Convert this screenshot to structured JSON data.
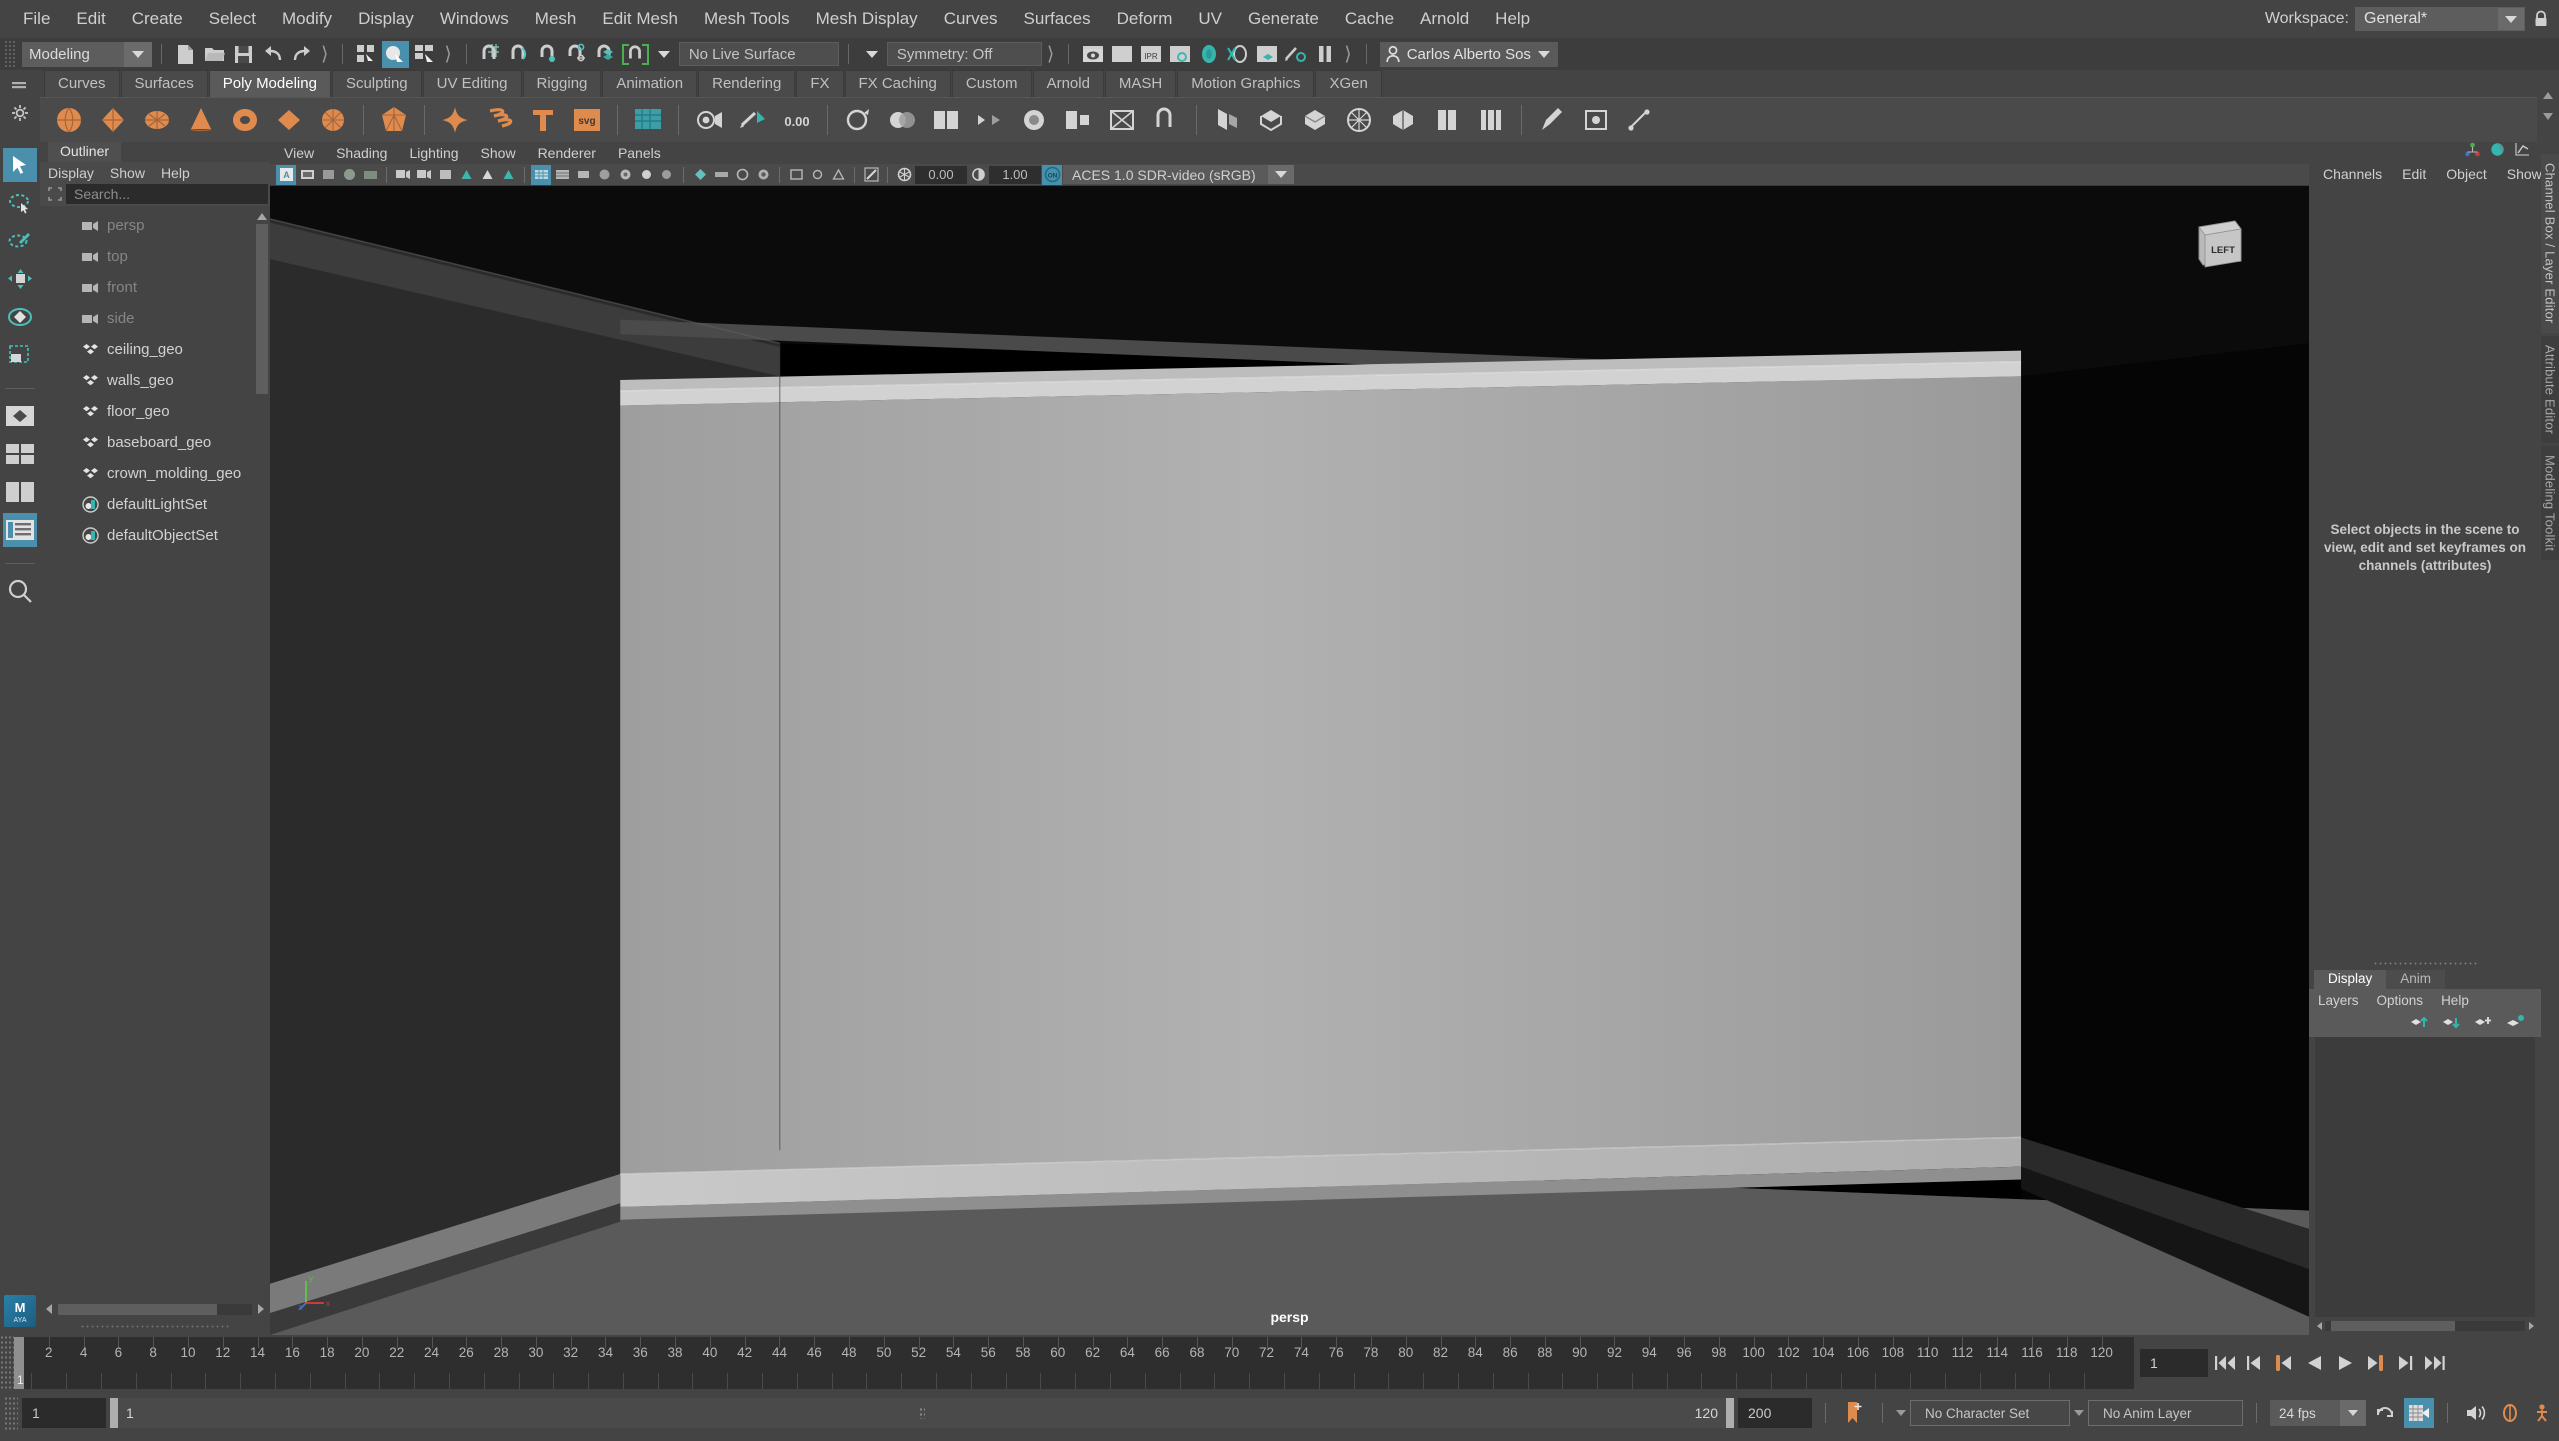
{
  "menubar": {
    "items": [
      "File",
      "Edit",
      "Create",
      "Select",
      "Modify",
      "Display",
      "Windows",
      "Mesh",
      "Edit Mesh",
      "Mesh Tools",
      "Mesh Display",
      "Curves",
      "Surfaces",
      "Deform",
      "UV",
      "Generate",
      "Cache",
      "Arnold",
      "Help"
    ],
    "workspace_label": "Workspace:",
    "workspace_value": "General*"
  },
  "statusline": {
    "menu_set": "Modeling",
    "live_surface": "No Live Surface",
    "symmetry": "Symmetry: Off",
    "user": "Carlos Alberto Sos"
  },
  "shelf": {
    "tabs": [
      "Curves",
      "Surfaces",
      "Poly Modeling",
      "Sculpting",
      "UV Editing",
      "Rigging",
      "Animation",
      "Rendering",
      "FX",
      "FX Caching",
      "Custom",
      "Arnold",
      "MASH",
      "Motion Graphics",
      "XGen"
    ],
    "active_tab": "Poly Modeling",
    "svg_label": "svg"
  },
  "outliner": {
    "title": "Outliner",
    "menu": [
      "Display",
      "Show",
      "Help"
    ],
    "search_placeholder": "Search...",
    "items": [
      {
        "label": "persp",
        "icon": "camera-icon",
        "dim": true
      },
      {
        "label": "top",
        "icon": "camera-icon",
        "dim": true
      },
      {
        "label": "front",
        "icon": "camera-icon",
        "dim": true
      },
      {
        "label": "side",
        "icon": "camera-icon",
        "dim": true
      },
      {
        "label": "ceiling_geo",
        "icon": "mesh-icon",
        "dim": false
      },
      {
        "label": "walls_geo",
        "icon": "mesh-icon",
        "dim": false
      },
      {
        "label": "floor_geo",
        "icon": "mesh-icon",
        "dim": false
      },
      {
        "label": "baseboard_geo",
        "icon": "mesh-icon",
        "dim": false
      },
      {
        "label": "crown_molding_geo",
        "icon": "mesh-icon",
        "dim": false
      },
      {
        "label": "defaultLightSet",
        "icon": "set-icon",
        "dim": false
      },
      {
        "label": "defaultObjectSet",
        "icon": "set-icon",
        "dim": false
      }
    ]
  },
  "viewport": {
    "menu": [
      "View",
      "Shading",
      "Lighting",
      "Show",
      "Renderer",
      "Panels"
    ],
    "exposure": "0.00",
    "gamma": "1.00",
    "color_mgmt_toggle": "ON",
    "color_profile": "ACES 1.0 SDR-video (sRGB)",
    "camera_label": "persp",
    "viewcube_label": "LEFT",
    "axis_x": "x",
    "axis_y": "y",
    "axis_z": "z"
  },
  "channelbox": {
    "menu": [
      "Channels",
      "Edit",
      "Object",
      "Show"
    ],
    "empty_message": "Select objects in the scene to view, edit and set keyframes on channels (attributes)",
    "side_tab_primary": "Channel Box / Layer Editor",
    "side_tab_secondary": "Attribute Editor",
    "side_tab_tertiary": "Modeling Toolkit",
    "layer_tabs": [
      "Display",
      "Anim"
    ],
    "layer_active_tab": "Display",
    "layer_menu": [
      "Layers",
      "Options",
      "Help"
    ]
  },
  "timeline": {
    "ticks": [
      2,
      4,
      6,
      8,
      10,
      12,
      14,
      16,
      18,
      20,
      22,
      24,
      26,
      28,
      30,
      32,
      34,
      36,
      38,
      40,
      42,
      44,
      46,
      48,
      50,
      52,
      54,
      56,
      58,
      60,
      62,
      64,
      66,
      68,
      70,
      72,
      74,
      76,
      78,
      80,
      82,
      84,
      86,
      88,
      90,
      92,
      94,
      96,
      98,
      100,
      102,
      104,
      106,
      108,
      110,
      112,
      114,
      116,
      118,
      120
    ],
    "current_frame_label": "1",
    "current_frame_field": "1",
    "start_field": "1",
    "range_start": "1",
    "range_end": "120",
    "end_field": "200",
    "character_set": "No Character Set",
    "anim_layer": "No Anim Layer",
    "fps": "24 fps"
  }
}
